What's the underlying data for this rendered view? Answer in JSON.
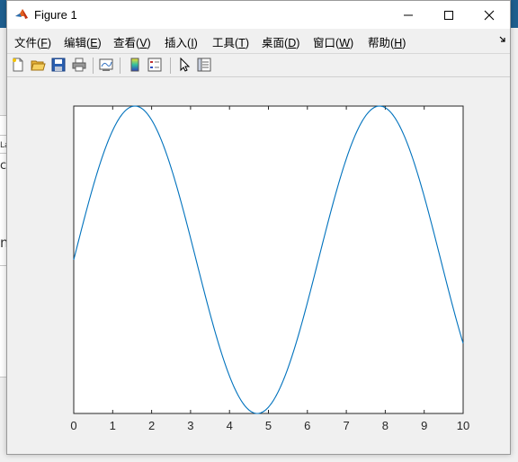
{
  "window": {
    "title": "Figure 1"
  },
  "menu": {
    "items": [
      {
        "text": "文件",
        "key": "F"
      },
      {
        "text": "编辑",
        "key": "E"
      },
      {
        "text": "查看",
        "key": "V"
      },
      {
        "text": "插入",
        "key": "I"
      },
      {
        "text": "工具",
        "key": "T"
      },
      {
        "text": "桌面",
        "key": "D"
      },
      {
        "text": "窗口",
        "key": "W"
      },
      {
        "text": "帮助",
        "key": "H"
      }
    ]
  },
  "toolbar": {
    "icons": [
      "new-figure-icon",
      "open-file-icon",
      "save-icon",
      "print-icon",
      "link-plot-icon",
      "colorbar-icon",
      "legend-icon",
      "edit-plot-arrow-icon",
      "property-inspector-icon"
    ]
  },
  "background_fragments": {
    "a": "La",
    "b": "ck",
    "c": "n"
  },
  "colors": {
    "line": "#0072bd",
    "axes_bg": "#ffffff",
    "figure_bg": "#f0f0f0"
  },
  "chart_data": {
    "type": "line",
    "x_function": "sin",
    "x_range": [
      0,
      10
    ],
    "xlim": [
      0,
      10
    ],
    "ylim": [
      -1,
      1
    ],
    "xticks": [
      "0",
      "1",
      "2",
      "3",
      "4",
      "5",
      "6",
      "7",
      "8",
      "9",
      "10"
    ],
    "yticks_visible": false,
    "grid": false,
    "series": [
      {
        "x": [
          0,
          0.5,
          1,
          1.5,
          1.5708,
          2,
          2.5,
          3,
          3.5,
          4,
          4.5,
          4.7124,
          5,
          5.5,
          6,
          6.5,
          7,
          7.5,
          7.854,
          8,
          8.5,
          9,
          9.5,
          10
        ],
        "y": [
          0,
          0.479,
          0.841,
          0.997,
          1,
          0.909,
          0.598,
          0.141,
          -0.351,
          -0.757,
          -0.978,
          -1,
          -0.959,
          -0.706,
          -0.279,
          0.215,
          0.657,
          0.938,
          1,
          0.989,
          0.798,
          0.412,
          -0.075,
          -0.544
        ]
      }
    ]
  }
}
